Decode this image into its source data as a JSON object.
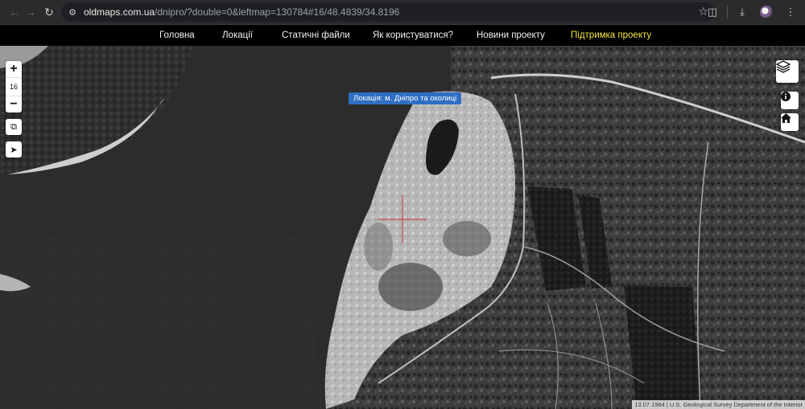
{
  "browser": {
    "url_domain": "oldmaps.com.ua",
    "url_path": "/dnipro/?double=0&leftmap=130784#16/48.4839/34.8196",
    "icons": {
      "back": "back-arrow-icon",
      "forward": "forward-arrow-icon",
      "reload": "reload-icon",
      "site_info": "site-settings-icon",
      "bookmark": "star-icon",
      "extensions": "puzzle-icon",
      "download": "download-icon",
      "profile": "avatar",
      "menu": "kebab-menu-icon"
    }
  },
  "site_nav": {
    "items": [
      {
        "label": "Головна"
      },
      {
        "label": "Локації"
      },
      {
        "label": "Статичні файли"
      },
      {
        "label": "Як користуватися?"
      },
      {
        "label": "Новини проекту"
      },
      {
        "label": "Підтримка проекту",
        "highlight": true
      }
    ],
    "highlight_color": "#f5e642"
  },
  "map": {
    "location_badge": "Локація: м. Дніпро та околиці",
    "badge_color": "#2f6fc4",
    "zoom": {
      "in_label": "+",
      "level": "16",
      "out_label": "−"
    },
    "left_tools": [
      "copy-icon",
      "locate-arrow-icon"
    ],
    "right_tools": [
      "layers-icon",
      "info-icon",
      "home-icon"
    ],
    "crosshair_color": "#d8323a",
    "attribution": {
      "date": "13.07.1984",
      "separator": "|",
      "source": "U.S. Geological Survey Department of the Interior"
    }
  }
}
